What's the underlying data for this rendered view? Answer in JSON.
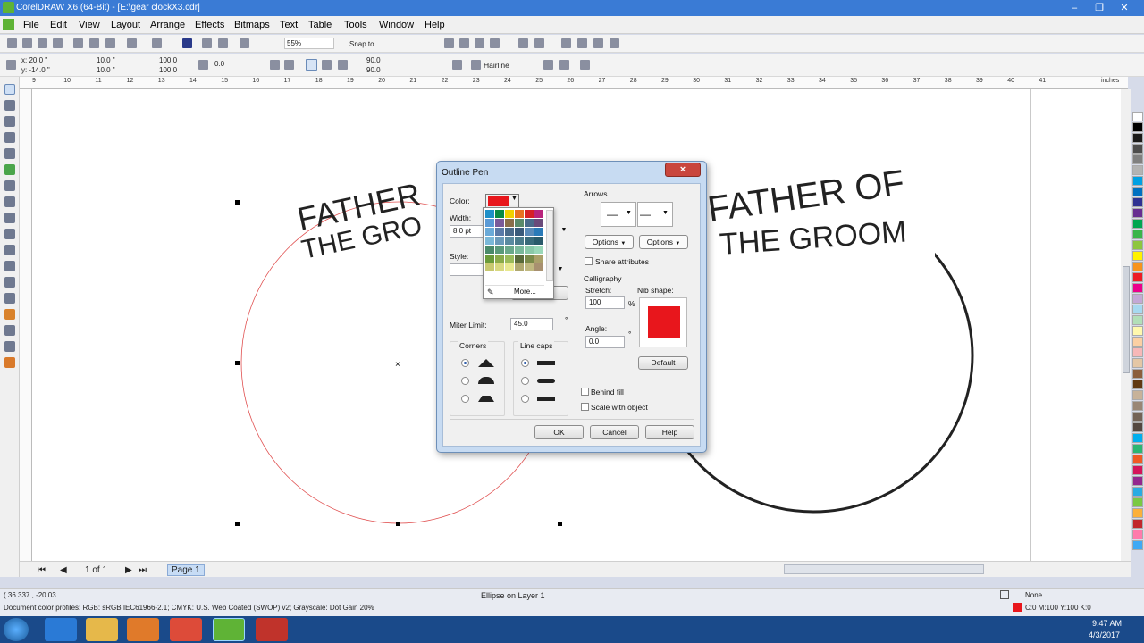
{
  "window": {
    "title": "CorelDRAW X6 (64-Bit) - [E:\\gear clockX3.cdr]"
  },
  "menu": [
    "File",
    "Edit",
    "View",
    "Layout",
    "Arrange",
    "Effects",
    "Bitmaps",
    "Text",
    "Table",
    "Tools",
    "Window",
    "Help"
  ],
  "toolbar": {
    "zoom": "55%",
    "snap_to": "Snap to"
  },
  "propertybar": {
    "x": "x: 20.0 \"",
    "y": "y: -14.0 \"",
    "w": "10.0 \"",
    "h": "10.0 \"",
    "scale_w": "100.0",
    "scale_h": "100.0",
    "rotation": "0.0",
    "angle1": "90.0",
    "angle2": "90.0",
    "outline_width": "Hairline"
  },
  "ruler": {
    "unit": "inches",
    "ticks": [
      "9",
      "10",
      "11",
      "12",
      "13",
      "14",
      "15",
      "16",
      "17",
      "18",
      "19",
      "20",
      "21",
      "22",
      "23",
      "24",
      "25",
      "26",
      "27",
      "28",
      "29",
      "30",
      "31",
      "32",
      "33",
      "34",
      "35",
      "36",
      "37",
      "38",
      "39",
      "40",
      "41"
    ]
  },
  "canvas": {
    "left_text_line1": "FATHER",
    "left_text_line2": "THE GRO",
    "right_text_line1": "FATHER OF",
    "right_text_line2": "THE GROOM"
  },
  "dialog": {
    "title": "Outline Pen",
    "color_label": "Color:",
    "width_label": "Width:",
    "width_value": "8.0 pt",
    "style_label": "Style:",
    "more_label": "More...",
    "miter_label": "Miter Limit:",
    "miter_value": "45.0",
    "miter_unit": "°",
    "corners_label": "Corners",
    "linecaps_label": "Line caps",
    "arrows_label": "Arrows",
    "options1": "Options",
    "options2": "Options",
    "share_attributes": "Share attributes",
    "calligraphy_label": "Calligraphy",
    "stretch_label": "Stretch:",
    "stretch_value": "100",
    "stretch_unit": "%",
    "nib_label": "Nib shape:",
    "angle_label": "Angle:",
    "angle_value": "0.0",
    "angle_unit": "°",
    "default_btn": "Default",
    "behind_fill": "Behind fill",
    "scale_with_object": "Scale with object",
    "ok": "OK",
    "cancel": "Cancel",
    "help": "Help",
    "selected_color": "#e8161c"
  },
  "popup_colors": [
    "#1e90c8",
    "#0a8a43",
    "#f0d000",
    "#e87020",
    "#d61f26",
    "#b8237c",
    "#5a9ad6",
    "#7a5a9a",
    "#8a6e4a",
    "#5a8a6a",
    "#4a6a8a",
    "#6a4a7a",
    "#6aaad8",
    "#5a7aa8",
    "#4a6a8a",
    "#3a5a7a",
    "#5a8ab8",
    "#2a7ab8",
    "#7ab8d8",
    "#6a9aba",
    "#5a8aa0",
    "#4a7a8a",
    "#3a6a7a",
    "#2a5a6a",
    "#4a8a6a",
    "#5a9a7a",
    "#6aa88a",
    "#7ab89a",
    "#8ac8a8",
    "#9ad8b8",
    "#6a9a3a",
    "#8aaa4a",
    "#9aba5a",
    "#5a6a3a",
    "#7a8a4a",
    "#aaa06a",
    "#c8c870",
    "#d8d880",
    "#e8e890",
    "#b0a870",
    "#c0b880",
    "#a89070"
  ],
  "nav": {
    "page_counter": "1 of 1",
    "page_tab": "Page 1"
  },
  "status": {
    "coords": "( 36.337 , -20.03...",
    "object_info": "Ellipse on Layer 1",
    "profiles": "Document color profiles: RGB: sRGB IEC61966-2.1; CMYK: U.S. Web Coated (SWOP) v2; Grayscale: Dot Gain 20%",
    "fill_info": "None",
    "outline_info": "C:0 M:100 Y:100 K:0"
  },
  "palette": [
    "#ffffff",
    "#000000",
    "#1a1a1a",
    "#4d4d4d",
    "#808080",
    "#b3b3b3",
    "#00a0e3",
    "#0070c0",
    "#2e3192",
    "#662d91",
    "#00a651",
    "#39b54a",
    "#8dc63f",
    "#fff200",
    "#f7941d",
    "#ed1c24",
    "#ec008c",
    "#c4a8d6",
    "#a7d9f0",
    "#b2dfb8",
    "#fff9ae",
    "#fbd0a3",
    "#f7b8b8",
    "#e4c7a5",
    "#8b5e3c",
    "#603913",
    "#c7b299",
    "#998675",
    "#736357",
    "#534741",
    "#00aeef",
    "#2bb673",
    "#f15a24",
    "#d4145a",
    "#93278f",
    "#29abe2",
    "#7ac943",
    "#fbb03b",
    "#c1272d",
    "#ff7bac",
    "#3fa9f5"
  ],
  "taskbar": {
    "time": "9:47 AM",
    "date": "4/3/2017"
  }
}
